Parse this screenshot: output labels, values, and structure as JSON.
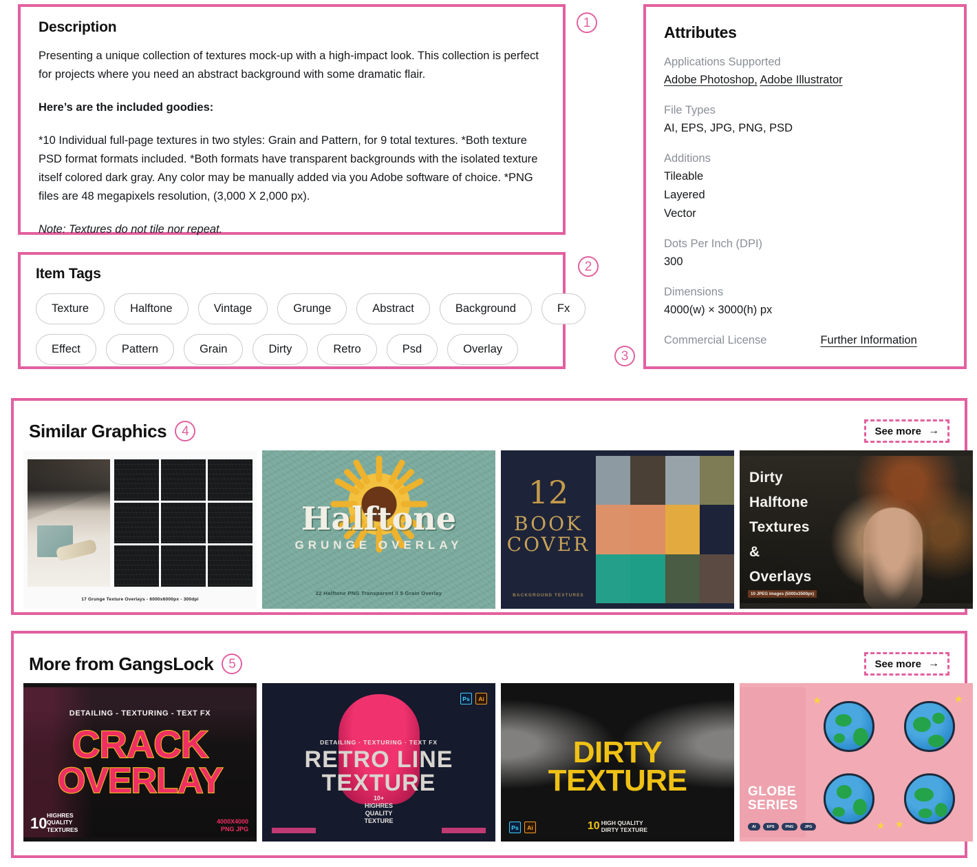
{
  "annotations": {
    "n1": "1",
    "n2": "2",
    "n3": "3",
    "n4": "4",
    "n5": "5"
  },
  "accent_color": "#e2609f",
  "description": {
    "heading": "Description",
    "paragraphs": [
      "Presenting a unique collection of textures mock-up with a high-impact look. This collection is perfect for projects where you need an abstract background with some dramatic flair.",
      "Here’s are the included goodies:",
      "*10 Individual full-page textures in two styles: Grain and Pattern, for 9 total textures. *Both texture PSD format formats included. *Both formats have transparent backgrounds with the isolated texture itself colored dark gray. Any color may be manually added via you Adobe software of choice. *PNG files are 48 megapixels resolution, (3,000 X 2,000 px).",
      "Note: Textures do not tile nor repeat."
    ]
  },
  "item_tags": {
    "heading": "Item Tags",
    "row1": [
      "Texture",
      "Halftone",
      "Vintage",
      "Grunge",
      "Abstract",
      "Background",
      "Fx"
    ],
    "row2": [
      "Effect",
      "Pattern",
      "Grain",
      "Dirty",
      "Retro",
      "Psd",
      "Overlay"
    ]
  },
  "attributes": {
    "heading": "Attributes",
    "applications_label": "Applications Supported",
    "applications": [
      "Adobe Photoshop,",
      "Adobe Illustrator"
    ],
    "file_types_label": "File Types",
    "file_types": "AI, EPS, JPG, PNG, PSD",
    "additions_label": "Additions",
    "additions": [
      "Tileable",
      "Layered",
      "Vector"
    ],
    "dpi_label": "Dots Per Inch (DPI)",
    "dpi": "300",
    "dimensions_label": "Dimensions",
    "dimensions": "4000(w) × 3000(h) px",
    "license_label": "Commercial License",
    "license_link": "Further Information"
  },
  "similar": {
    "title": "Similar Graphics",
    "see_more": "See more",
    "see_more_arrow": "→",
    "items": [
      {
        "name": "grunge-texture-overlays",
        "caption": "17 Grunge Texture Overlays   -   6000x6000px   -   300dpi"
      },
      {
        "name": "halftone-grunge-overlay",
        "title": "Halftone",
        "subtitle": "GRUNGE OVERLAY",
        "caption": "22 Halftone PNG Transparent // 5 Grain Overlay"
      },
      {
        "name": "book-cover-textures",
        "number": "12",
        "title_line1": "BOOK",
        "title_line2": "COVER",
        "caption": "BACKGROUND TEXTURES",
        "swatches": [
          "#8d9aa1",
          "#4a4036",
          "#98a3a9",
          "#7e7c55",
          "#dc9168",
          "#dd8e64",
          "#e3ab3f",
          "#1d2338",
          "#24a08a",
          "#1e9d87",
          "#4a5c43",
          "#5a4a42"
        ]
      },
      {
        "name": "dirty-halftone-textures-overlays",
        "lines": [
          "Dirty",
          "Halftone",
          "Textures",
          "&",
          "Overlays"
        ],
        "caption": "10 JPEG images (5000x3500px)"
      }
    ]
  },
  "more_from": {
    "title": "More from GangsLock",
    "see_more": "See more",
    "see_more_arrow": "→",
    "items": [
      {
        "name": "crack-overlay",
        "kicker": "DETAILING - TEXTURING - TEXT FX",
        "line1": "CRACK",
        "line2": "OVERLAY",
        "badge_number": "10",
        "badge_text": "HIGHRES\nQUALITY\nTEXTURES",
        "corner_text": "4000X4000\nPNG  JPG"
      },
      {
        "name": "retro-line-texture",
        "kicker": "DETAILING · TEXTURING · TEXT FX",
        "line1": "RETRO LINE",
        "line2": "TEXTURE",
        "footer": "10+\nHIGHRES\nQUALITY\nTEXTURE",
        "badges": [
          "Ps",
          "Ai"
        ]
      },
      {
        "name": "dirty-texture",
        "line1": "DIRTY",
        "line2": "TEXTURE",
        "badge_number": "10",
        "caption": "HIGH QUALITY\nDIRTY TEXTURE",
        "badges": [
          "Ps",
          "Ai"
        ]
      },
      {
        "name": "globe-series",
        "title_line1": "GLOBE",
        "title_line2": "SERIES",
        "badges": [
          "AI",
          "EPS",
          "PNG",
          "JPG"
        ]
      }
    ]
  }
}
